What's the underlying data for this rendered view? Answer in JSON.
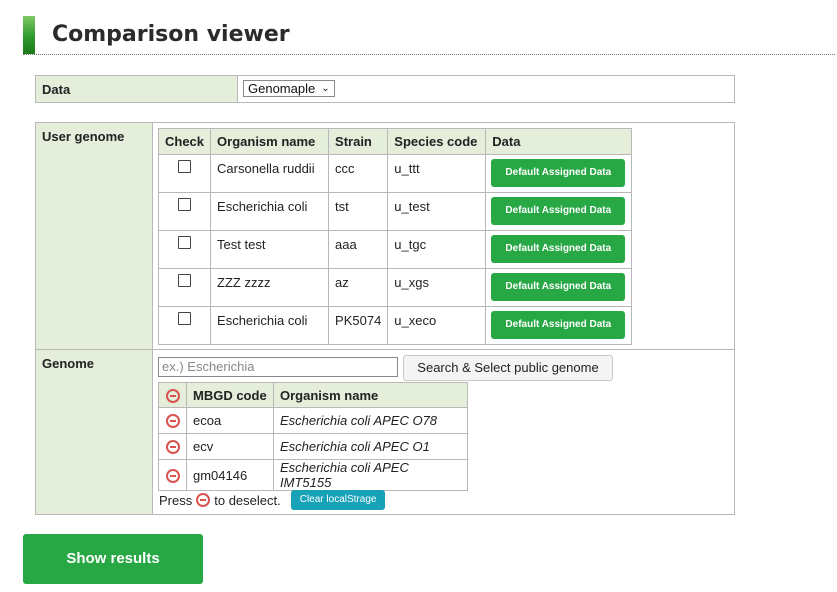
{
  "header": {
    "title": "Comparison viewer"
  },
  "data_row": {
    "label": "Data",
    "selected": "Genomaple"
  },
  "user_genome": {
    "label": "User genome",
    "columns": [
      "Check",
      "Organism name",
      "Strain",
      "Species code",
      "Data"
    ],
    "rows": [
      {
        "organism": "Carsonella ruddii",
        "strain": "ccc",
        "code": "u_ttt",
        "button": "Default Assigned Data"
      },
      {
        "organism": "Escherichia coli",
        "strain": "tst",
        "code": "u_test",
        "button": "Default Assigned Data"
      },
      {
        "organism": "Test test",
        "strain": "aaa",
        "code": "u_tgc",
        "button": "Default Assigned Data"
      },
      {
        "organism": "ZZZ zzzz",
        "strain": "az",
        "code": "u_xgs",
        "button": "Default Assigned Data"
      },
      {
        "organism": "Escherichia coli",
        "strain": "PK5074",
        "code": "u_xeco",
        "button": "Default Assigned Data"
      }
    ]
  },
  "genome": {
    "label": "Genome",
    "search_placeholder": "ex.) Escherichia",
    "search_button": "Search & Select public genome",
    "columns": [
      "MBGD code",
      "Organism name"
    ],
    "rows": [
      {
        "code": "ecoa",
        "organism": "Escherichia coli APEC O78"
      },
      {
        "code": "ecv",
        "organism": "Escherichia coli APEC O1"
      },
      {
        "code": "gm04146",
        "organism": "Escherichia coli APEC IMT5155"
      }
    ],
    "press_text_before": "Press",
    "press_text_after": "to deselect.",
    "clear_button": "Clear localStrage"
  },
  "show_results": "Show results",
  "colors": {
    "accent_green": "#28a745",
    "label_bg": "#e4eedb",
    "remove_red": "#d9534f",
    "clear_cyan": "#17a2b8"
  },
  "icons": {
    "remove": "minus-circle-icon",
    "dropdown": "chevron-down-icon"
  }
}
